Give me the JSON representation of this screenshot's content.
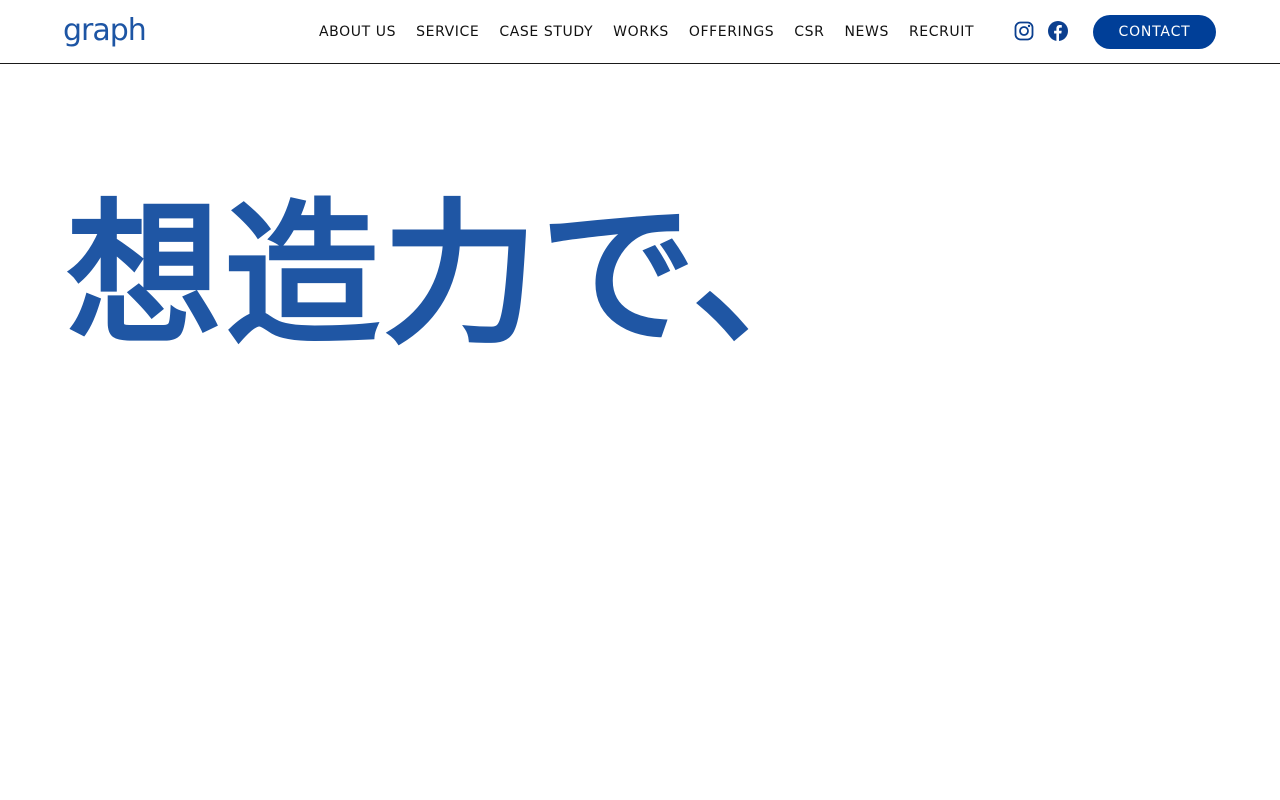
{
  "brand": {
    "logo_text": "graph",
    "color": "#1d55a4"
  },
  "nav": {
    "items": [
      {
        "label": "ABOUT US"
      },
      {
        "label": "SERVICE"
      },
      {
        "label": "CASE STUDY"
      },
      {
        "label": "WORKS"
      },
      {
        "label": "OFFERINGS"
      },
      {
        "label": "CSR"
      },
      {
        "label": "NEWS"
      },
      {
        "label": "RECRUIT"
      }
    ]
  },
  "social": {
    "icons": [
      "instagram-icon",
      "facebook-icon"
    ],
    "color": "#0b3f8f"
  },
  "contact": {
    "label": "CONTACT",
    "background": "#003f98"
  },
  "hero": {
    "heading": "想造力で、",
    "color": "#1f56a4"
  }
}
